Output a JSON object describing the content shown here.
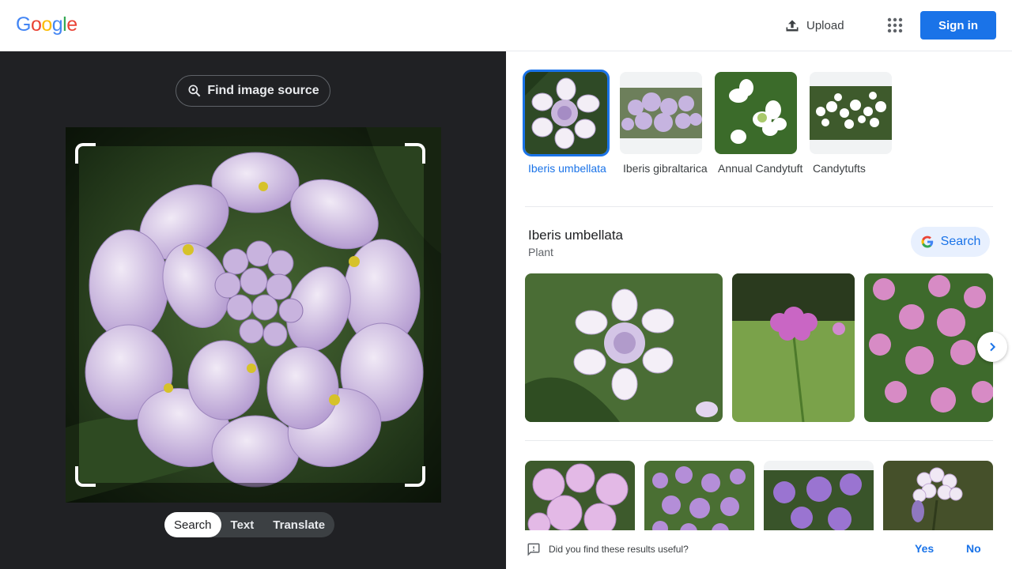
{
  "header": {
    "logo_letters": [
      {
        "ch": "G",
        "color": "#4285F4"
      },
      {
        "ch": "o",
        "color": "#EA4335"
      },
      {
        "ch": "o",
        "color": "#FBBC05"
      },
      {
        "ch": "g",
        "color": "#4285F4"
      },
      {
        "ch": "l",
        "color": "#34A853"
      },
      {
        "ch": "e",
        "color": "#EA4335"
      }
    ],
    "upload_label": "Upload",
    "apps_icon": "apps-grid-icon",
    "signin_label": "Sign in"
  },
  "lens": {
    "find_source_label": "Find image source",
    "modes": [
      {
        "label": "Search",
        "active": true
      },
      {
        "label": "Text",
        "active": false
      },
      {
        "label": "Translate",
        "active": false
      }
    ]
  },
  "results": {
    "thumbnails": [
      {
        "label": "Iberis umbellata",
        "selected": true
      },
      {
        "label": "Iberis gibraltarica",
        "selected": false
      },
      {
        "label": "Annual Candytuft",
        "selected": false
      },
      {
        "label": "Candytufts",
        "selected": false
      }
    ],
    "entity": {
      "title": "Iberis umbellata",
      "subtitle": "Plant",
      "search_label": "Search"
    },
    "feedback": {
      "question": "Did you find these results useful?",
      "yes": "Yes",
      "no": "No"
    }
  },
  "colors": {
    "accent": "#1a73e8",
    "dark_panel": "#202124"
  }
}
